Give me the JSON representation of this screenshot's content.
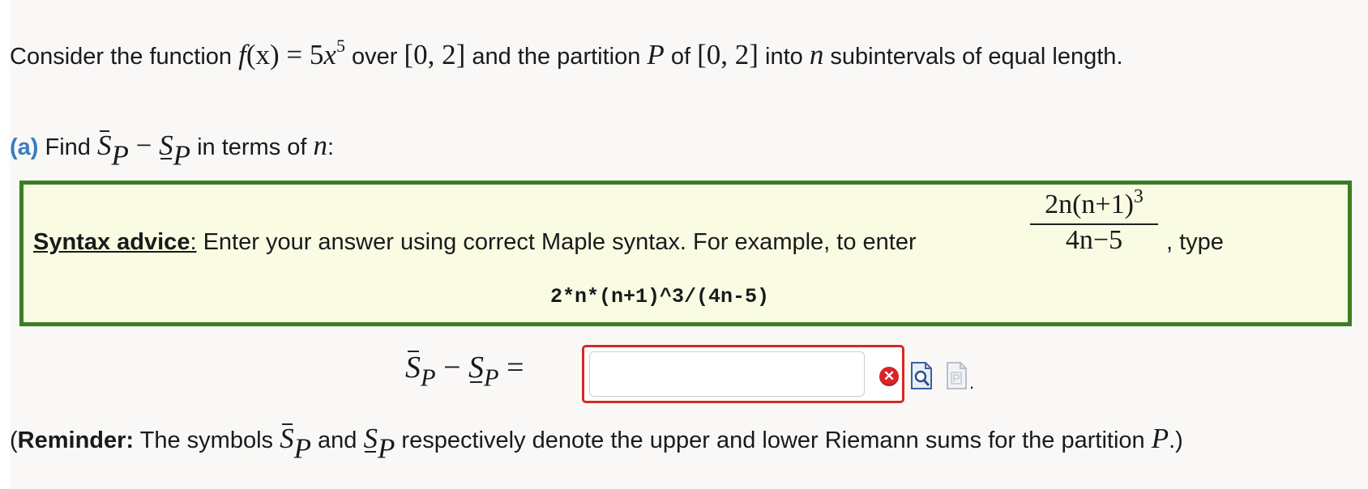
{
  "question": {
    "intro_1": "Consider the function ",
    "func": "f",
    "func_arg": "(x)",
    "equals_coeff": " = 5",
    "var_x": "x",
    "exponent": "5",
    "over": " over ",
    "interval_1": "[0, 2]",
    "and_partition": " and the partition ",
    "P": "P",
    "of": " of ",
    "interval_2": "[0, 2]",
    "into": " into ",
    "n": "n",
    "rest": " subintervals of equal length."
  },
  "part_a": {
    "label": "(a)",
    "find": " Find ",
    "S": "S",
    "P": "P",
    "minus": " − ",
    "in_terms": " in terms of ",
    "n": "n",
    "colon": ":"
  },
  "advice": {
    "heading": "Syntax advice",
    "heading_colon": ":",
    "text": "  Enter your answer using correct Maple syntax. For example, to enter",
    "frac_num": "2n(n+1)",
    "frac_num_exp": "3",
    "frac_den": "4n−5",
    "type_text": ", type",
    "code": "2*n*(n+1)^3/(4n-5)"
  },
  "answer": {
    "S": "S",
    "P": "P",
    "minus": " − ",
    "equals": " =",
    "value": "",
    "placeholder": "",
    "error_icon": "x-circle-icon",
    "preview_icon": "preview-icon",
    "disabled_icon": "document-p-icon",
    "period": "."
  },
  "reminder": {
    "open": "(",
    "bold": "Reminder:",
    "text1": " The symbols ",
    "S": "S",
    "P": "P",
    "and": " and ",
    "text2": " respectively denote the upper and lower Riemann sums for the partition ",
    "close": ".)"
  },
  "colors": {
    "accent_label": "#3a7dbf",
    "advice_border": "#3b7d23",
    "advice_bg": "#fafbe3",
    "error_border": "#d42a24"
  }
}
